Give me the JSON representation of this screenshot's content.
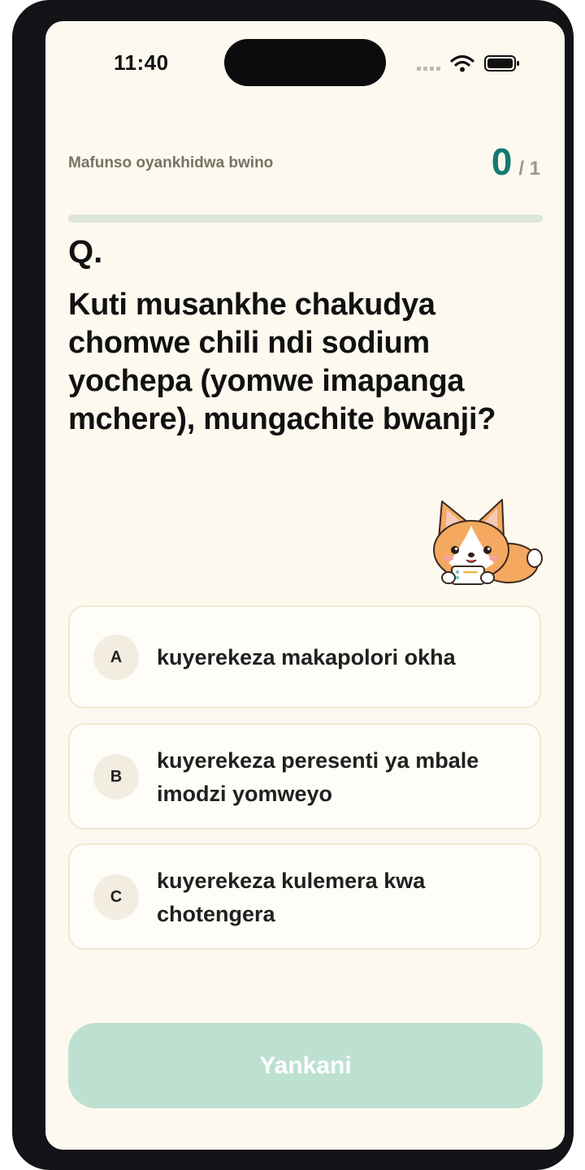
{
  "status_bar": {
    "time": "11:40"
  },
  "header": {
    "score_label": "Mafunso oyankhidwa bwino",
    "score_value": "0",
    "score_total": "/ 1",
    "progress": 0
  },
  "question": {
    "marker": "Q.",
    "text": "Kuti musankhe chakudya chomwe chili ndi sodium yochepa (yomwe imapanga mchere), mungachite bwanji?"
  },
  "options": [
    {
      "letter": "A",
      "text": "kuyerekeza makapolori okha"
    },
    {
      "letter": "B",
      "text": "kuyerekeza peresenti ya mbale imodzi yomweyo"
    },
    {
      "letter": "C",
      "text": "kuyerekeza kulemera kwa chotengera"
    }
  ],
  "next_button": {
    "label": "Yankani"
  },
  "colors": {
    "accent": "#137a70",
    "background": "#fdf9ef",
    "button_disabled": "#bde0d1"
  },
  "icons": [
    "signal-icon",
    "wifi-icon",
    "battery-icon",
    "corgi-mascot"
  ]
}
